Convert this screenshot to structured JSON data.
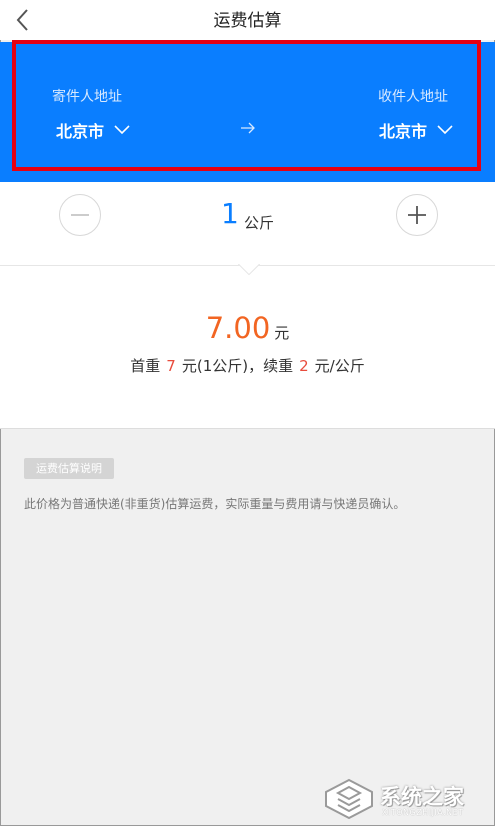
{
  "header": {
    "title": "运费估算",
    "back_icon": "chevron-left-icon"
  },
  "address": {
    "sender_label": "寄件人地址",
    "receiver_label": "收件人地址",
    "sender_city": "北京市",
    "receiver_city": "北京市",
    "panel_color": "#0a7eff",
    "highlight_color": "#e60012"
  },
  "weight": {
    "value": "1",
    "unit": "公斤"
  },
  "price": {
    "amount": "7.00",
    "unit": "元",
    "first_weight_label": "首重",
    "first_weight_price": "7",
    "first_weight_unit": "元(1公斤)，续重",
    "extra_price": "2",
    "extra_unit": "元/公斤",
    "price_color": "#f26522"
  },
  "note": {
    "tag": "运费估算说明",
    "text": "此价格为普通快递(非重货)估算运费，实际重量与费用请与快递员确认。"
  },
  "watermark": {
    "name": "系统之家",
    "sub": "XITONGZHIJIA.NET"
  }
}
